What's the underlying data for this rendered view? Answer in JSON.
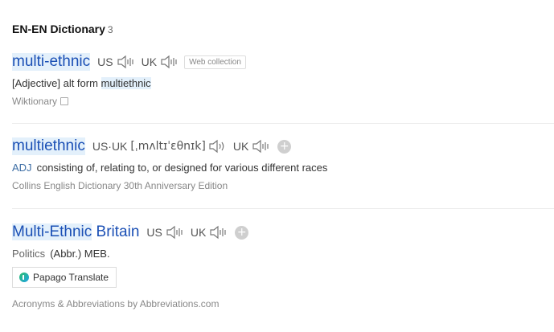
{
  "dictionary": {
    "title": "EN-EN Dictionary",
    "count": "3"
  },
  "entries": [
    {
      "word": "multi-ethnic",
      "us_label": "US",
      "uk_label": "UK",
      "tag": "Web collection",
      "def_prefix": "[Adjective] alt form ",
      "def_link": "multiethnic",
      "source": "Wiktionary"
    },
    {
      "word": "multiethnic",
      "us_uk_label": "US·UK",
      "pronunciation": "[ˌmʌltɪˈɛθnɪk]",
      "uk_label": "UK",
      "pos": "ADJ",
      "definition": "consisting of, relating to, or designed for various different races",
      "source": "Collins English Dictionary 30th Anniversary Edition"
    },
    {
      "word_part1": "Multi-Ethnic",
      "word_part2": " Britain",
      "us_label": "US",
      "uk_label": "UK",
      "pos": "Politics",
      "definition": "(Abbr.) MEB.",
      "papago_label": "Papago Translate",
      "source": "Acronyms & Abbreviations by Abbreviations.com"
    }
  ],
  "icons": {
    "speaker": "speaker-icon",
    "plus": "add-to-wordbook-icon",
    "external": "external-link-icon",
    "papago": "papago-logo-icon"
  }
}
